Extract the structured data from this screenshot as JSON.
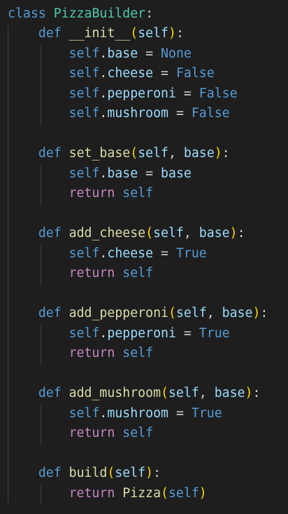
{
  "theme": {
    "background": "#1e1e1e",
    "keyword_color": "#569cd6",
    "class_name_color": "#4ec9b0",
    "function_name_color": "#dcdcaa",
    "variable_color": "#9cdcfe",
    "control_keyword_color": "#c586c0",
    "bracket_color": "#ffd700",
    "bracket_nested_color": "#da70d6",
    "default_text_color": "#d4d4d4",
    "indent_guide_color": "#404040"
  },
  "code": {
    "language": "python",
    "tokens": {
      "class": "class",
      "def": "def",
      "return": "return",
      "self": "self",
      "None": "None",
      "True": "True",
      "False": "False",
      "colon": ":",
      "comma": ",",
      "dot": ".",
      "eq": "=",
      "lparen": "(",
      "rparen": ")"
    },
    "class_name": "PizzaBuilder",
    "methods": {
      "init": "__init__",
      "set_base": "set_base",
      "add_cheese": "add_cheese",
      "add_pepperoni": "add_pepperoni",
      "add_mushroom": "add_mushroom",
      "build": "build"
    },
    "attrs": {
      "base": "base",
      "cheese": "cheese",
      "pepperoni": "pepperoni",
      "mushroom": "mushroom"
    },
    "params": {
      "base": "base"
    },
    "builtins": {
      "pizza": "Pizza"
    }
  }
}
